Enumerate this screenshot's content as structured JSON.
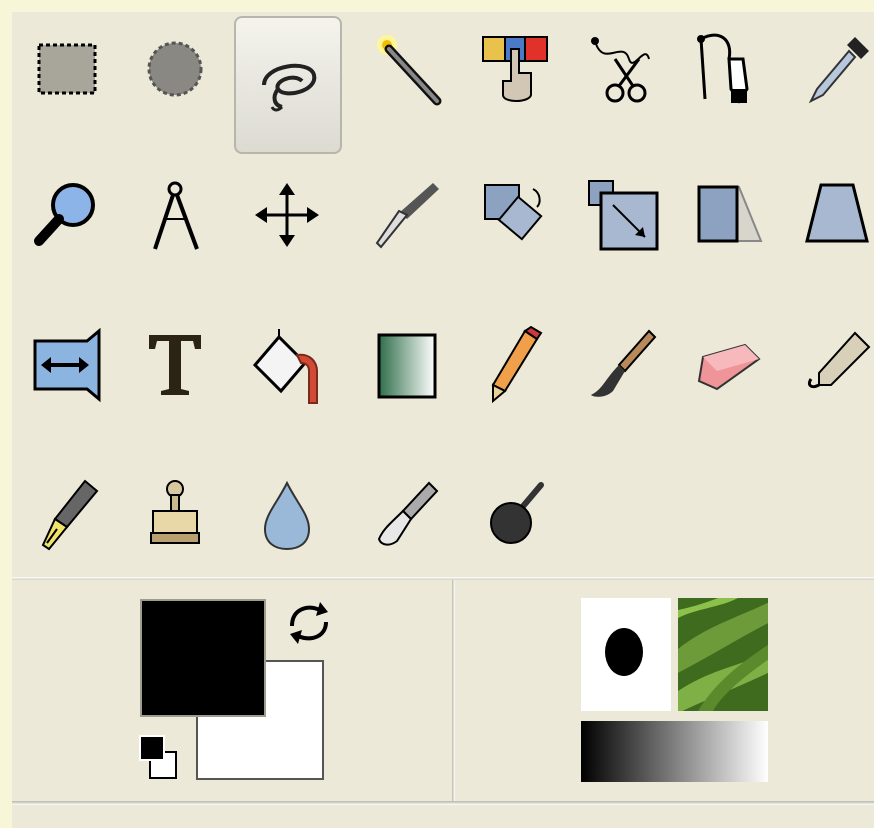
{
  "window": {
    "title": ""
  },
  "tools": [
    {
      "name": "rectangle-select-icon",
      "active": false
    },
    {
      "name": "ellipse-select-icon",
      "active": false
    },
    {
      "name": "free-select-lasso-icon",
      "active": true
    },
    {
      "name": "fuzzy-select-magic-wand-icon",
      "active": false
    },
    {
      "name": "select-by-color-icon",
      "active": false
    },
    {
      "name": "scissors-select-icon",
      "active": false
    },
    {
      "name": "paths-pen-icon",
      "active": false
    },
    {
      "name": "color-picker-eyedropper-icon",
      "active": false
    },
    {
      "name": "zoom-magnifier-icon",
      "active": false
    },
    {
      "name": "measure-compass-icon",
      "active": false
    },
    {
      "name": "move-icon",
      "active": false
    },
    {
      "name": "crop-knife-icon",
      "active": false
    },
    {
      "name": "rotate-icon",
      "active": false
    },
    {
      "name": "scale-icon",
      "active": false
    },
    {
      "name": "shear-icon",
      "active": false
    },
    {
      "name": "perspective-icon",
      "active": false
    },
    {
      "name": "flip-icon",
      "active": false
    },
    {
      "name": "text-icon",
      "active": false
    },
    {
      "name": "bucket-fill-icon",
      "active": false
    },
    {
      "name": "blend-gradient-icon",
      "active": false
    },
    {
      "name": "pencil-icon",
      "active": false
    },
    {
      "name": "paintbrush-icon",
      "active": false
    },
    {
      "name": "eraser-icon",
      "active": false
    },
    {
      "name": "airbrush-icon",
      "active": false
    },
    {
      "name": "ink-pen-icon",
      "active": false
    },
    {
      "name": "clone-stamp-icon",
      "active": false
    },
    {
      "name": "blur-sharpen-drop-icon",
      "active": false
    },
    {
      "name": "smudge-icon",
      "active": false
    },
    {
      "name": "dodge-burn-icon",
      "active": false
    }
  ],
  "colors": {
    "foreground": "#000000",
    "background": "#ffffff",
    "panel_bg": "#ece9d8",
    "active_tool_border": "#b8b6aa"
  },
  "indicators": {
    "swap_colors_icon": "swap-arrows-icon",
    "reset_colors_icon": "default-colors-icon",
    "brush": "round-brush",
    "pattern": "green-leaves",
    "gradient": "black-to-white"
  }
}
